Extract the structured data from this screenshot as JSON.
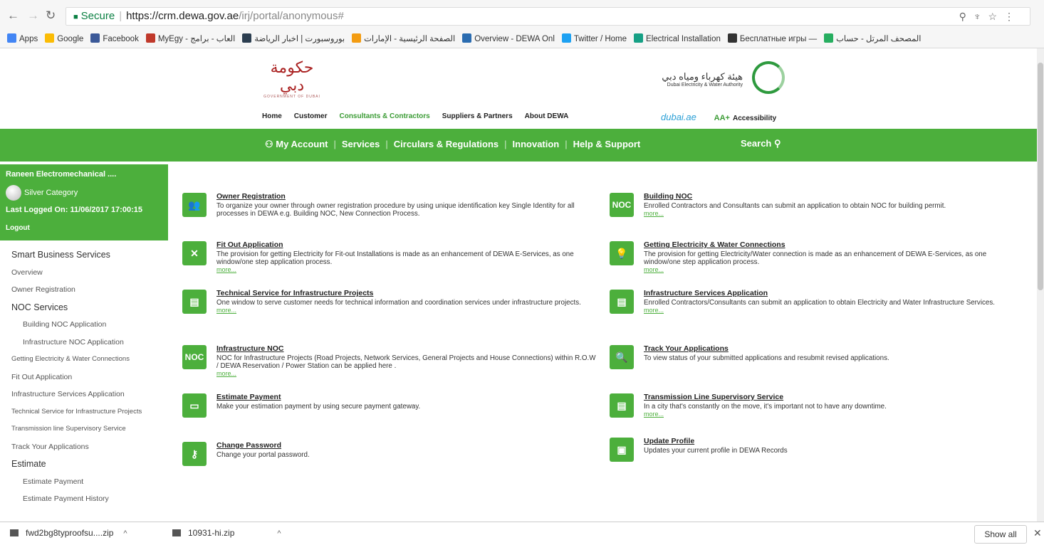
{
  "browser": {
    "secure_label": "Secure",
    "url_host": "https://crm.dewa.gov.ae",
    "url_path": "/irj/portal/anonymous#",
    "bookmarks": [
      {
        "label": "Apps",
        "color": "#4285f4"
      },
      {
        "label": "Google",
        "color": "#fbbc05"
      },
      {
        "label": "Facebook",
        "color": "#3b5998"
      },
      {
        "label": "MyEgy - العاب - برامج",
        "color": "#c0392b"
      },
      {
        "label": "بوروسبورت | اخبار الرياضة",
        "color": "#2c3e50"
      },
      {
        "label": "الصفحة الرئيسية - الإمارات",
        "color": "#f39c12"
      },
      {
        "label": "Overview - DEWA Onl",
        "color": "#2b6cb0"
      },
      {
        "label": "Twitter / Home",
        "color": "#1da1f2"
      },
      {
        "label": "Electrical Installation",
        "color": "#16a085"
      },
      {
        "label": "Бесплатные игры —",
        "color": "#333333"
      },
      {
        "label": "المصحف المرتل - حساب",
        "color": "#27ae60"
      }
    ]
  },
  "header": {
    "gov_logo_ar": "حكومة دبي",
    "gov_logo_en": "GOVERNMENT OF DUBAI",
    "dewa_logo_ar": "هيئة كهرباء ومياه دبي",
    "dewa_logo_en": "Dubai Electricity & Water Authority",
    "topnav": [
      "Home",
      "Customer",
      "Consultants & Contractors",
      "Suppliers & Partners",
      "About DEWA"
    ],
    "topnav_active": "Consultants & Contractors",
    "dubai_logo": "dubai.ae",
    "accessibility_aa": "AA+",
    "accessibility": "Accessibility"
  },
  "greenbar": {
    "items": [
      "My Account",
      "Services",
      "Circulars & Regulations",
      "Innovation",
      "Help & Support"
    ],
    "search": "Search"
  },
  "user": {
    "name": "Raneen Electromechanical ....",
    "category": "Silver Category",
    "last_logged": "Last Logged On: 11/06/2017 17:00:15",
    "logout": "Logout"
  },
  "menu": [
    {
      "label": "Smart Business Services",
      "kind": "hdr"
    },
    {
      "label": "Overview",
      "kind": "item"
    },
    {
      "label": "Owner Registration",
      "kind": "item"
    },
    {
      "label": "NOC Services",
      "kind": "hdr"
    },
    {
      "label": "Building NOC Application",
      "kind": "sub"
    },
    {
      "label": "Infrastructure NOC Application",
      "kind": "sub"
    },
    {
      "label": "Getting Electricity & Water Connections",
      "kind": "item"
    },
    {
      "label": "Fit Out Application",
      "kind": "item"
    },
    {
      "label": "Infrastructure Services Application",
      "kind": "item"
    },
    {
      "label": "Technical Service for Infrastructure Projects",
      "kind": "item"
    },
    {
      "label": "Transmission line Supervisory Service",
      "kind": "item"
    },
    {
      "label": "Track Your Applications",
      "kind": "item"
    },
    {
      "label": "Estimate",
      "kind": "hdr"
    },
    {
      "label": "Estimate Payment",
      "kind": "sub"
    },
    {
      "label": "Estimate Payment History",
      "kind": "sub"
    }
  ],
  "services_left": [
    {
      "title": "Owner Registration",
      "desc": "To organize your owner through owner registration procedure by using unique identification key Single Identity for all processes in DEWA e.g. Building NOC, New Connection Process.",
      "more": "",
      "icon": "users-icon",
      "glyph": "👥"
    },
    {
      "title": "Fit Out Application",
      "desc": "The provision for getting Electricity for Fit-out Installations is made as an enhancement of DEWA E-Services, as one window/one step application process.",
      "more": "more...",
      "icon": "tools-icon",
      "glyph": "✕"
    },
    {
      "title": "Technical Service for Infrastructure Projects",
      "desc": "One window to serve customer needs for technical information and coordination services under infrastructure projects.",
      "more": "more...",
      "icon": "document-icon",
      "glyph": "▤"
    },
    {
      "title": "Infrastructure NOC",
      "desc": "NOC for Infrastructure Projects (Road Projects, Network Services, General Projects and House Connections) within R.O.W / DEWA Reservation / Power Station can be applied here .",
      "more": "more...",
      "icon": "noc-icon",
      "glyph": "NOC"
    },
    {
      "title": "Estimate Payment",
      "desc": "Make your estimation payment by using secure payment gateway.",
      "more": "",
      "icon": "card-icon",
      "glyph": "▭"
    },
    {
      "title": "Change Password",
      "desc": "Change your portal password.",
      "more": "",
      "icon": "key-icon",
      "glyph": "⚷"
    }
  ],
  "services_right": [
    {
      "title": "Building NOC",
      "desc": "Enrolled Contractors and Consultants can submit an application to obtain NOC for building permit.",
      "more": "more...",
      "icon": "noc-icon",
      "glyph": "NOC"
    },
    {
      "title": "Getting Electricity & Water Connections",
      "desc": "The provision for getting Electricity/Water connection is made as an enhancement of DEWA E-Services, as one window/one step application process.",
      "more": "more...",
      "icon": "bulb-icon",
      "glyph": "💡"
    },
    {
      "title": "Infrastructure Services Application",
      "desc": "Enrolled Contractors/Consultants can submit an application to obtain Electricity and Water Infrastructure Services.",
      "more": "more...",
      "icon": "document-icon",
      "glyph": "▤"
    },
    {
      "title": "Track Your Applications",
      "desc": "To view status of your submitted applications and resubmit revised applications.",
      "more": "",
      "icon": "magnifier-icon",
      "glyph": "🔍"
    },
    {
      "title": "Transmission Line Supervisory Service",
      "desc": "In a city that's constantly on the move, it's important not to have any downtime.",
      "more": "more...",
      "icon": "document-icon",
      "glyph": "▤"
    },
    {
      "title": "Update Profile",
      "desc": "Updates your current profile in DEWA Records",
      "more": "",
      "icon": "profile-icon",
      "glyph": "▣"
    }
  ],
  "downloads": {
    "files": [
      "fwd2bg8typroofsu....zip",
      "10931-hi.zip"
    ],
    "show_all": "Show all"
  },
  "colors": {
    "green": "#4caf3c"
  }
}
